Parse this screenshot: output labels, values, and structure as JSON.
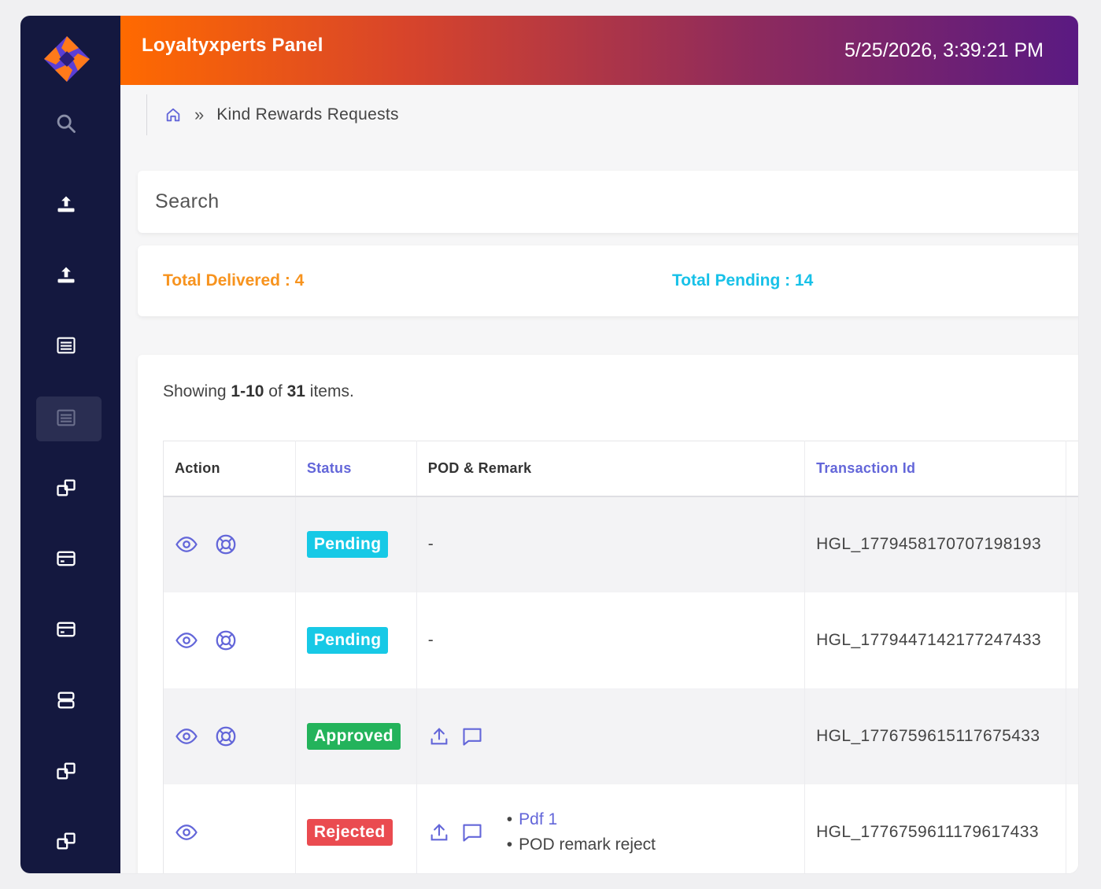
{
  "header": {
    "title": "Loyaltyxperts Panel",
    "datetime": "5/25/2026, 3:39:21 PM",
    "gradient": [
      "#ff6a00",
      "#5a1a82"
    ]
  },
  "sidebar": {
    "bg": "#14183f",
    "items": [
      {
        "name": "search-icon"
      },
      {
        "name": "upload-icon"
      },
      {
        "name": "upload-icon"
      },
      {
        "name": "list-icon"
      },
      {
        "name": "list-icon",
        "active": true
      },
      {
        "name": "windows-icon"
      },
      {
        "name": "card-icon"
      },
      {
        "name": "card-icon"
      },
      {
        "name": "server-icon"
      },
      {
        "name": "windows-icon"
      },
      {
        "name": "windows-icon"
      }
    ]
  },
  "breadcrumb": {
    "separator": "»",
    "current": "Kind Rewards Requests"
  },
  "search": {
    "placeholder": "Search"
  },
  "totals": {
    "delivered": "Total Delivered : 4",
    "pending": "Total Pending : 14"
  },
  "summary": {
    "prefix": "Showing ",
    "range": "1-10",
    "middle": " of ",
    "total": "31",
    "suffix": " items."
  },
  "table": {
    "columns": [
      "Action",
      "Status",
      "POD & Remark",
      "Transaction Id"
    ],
    "rows": [
      {
        "status": "Pending",
        "pod": "-",
        "txn": "HGL_1779458170707198193"
      },
      {
        "status": "Pending",
        "pod": "-",
        "txn": "HGL_1779447142177247433"
      },
      {
        "status": "Approved",
        "txn": "HGL_1776759615117675433"
      },
      {
        "status": "Rejected",
        "remark_pdf": "Pdf 1",
        "remark_text": "POD remark reject",
        "txn": "HGL_1776759611179617433"
      }
    ]
  },
  "colors": {
    "accent": "#6366d9",
    "delivered": "#f7931e",
    "pending": "#17c9e6",
    "approved": "#23b35b",
    "rejected": "#ea4b50"
  }
}
